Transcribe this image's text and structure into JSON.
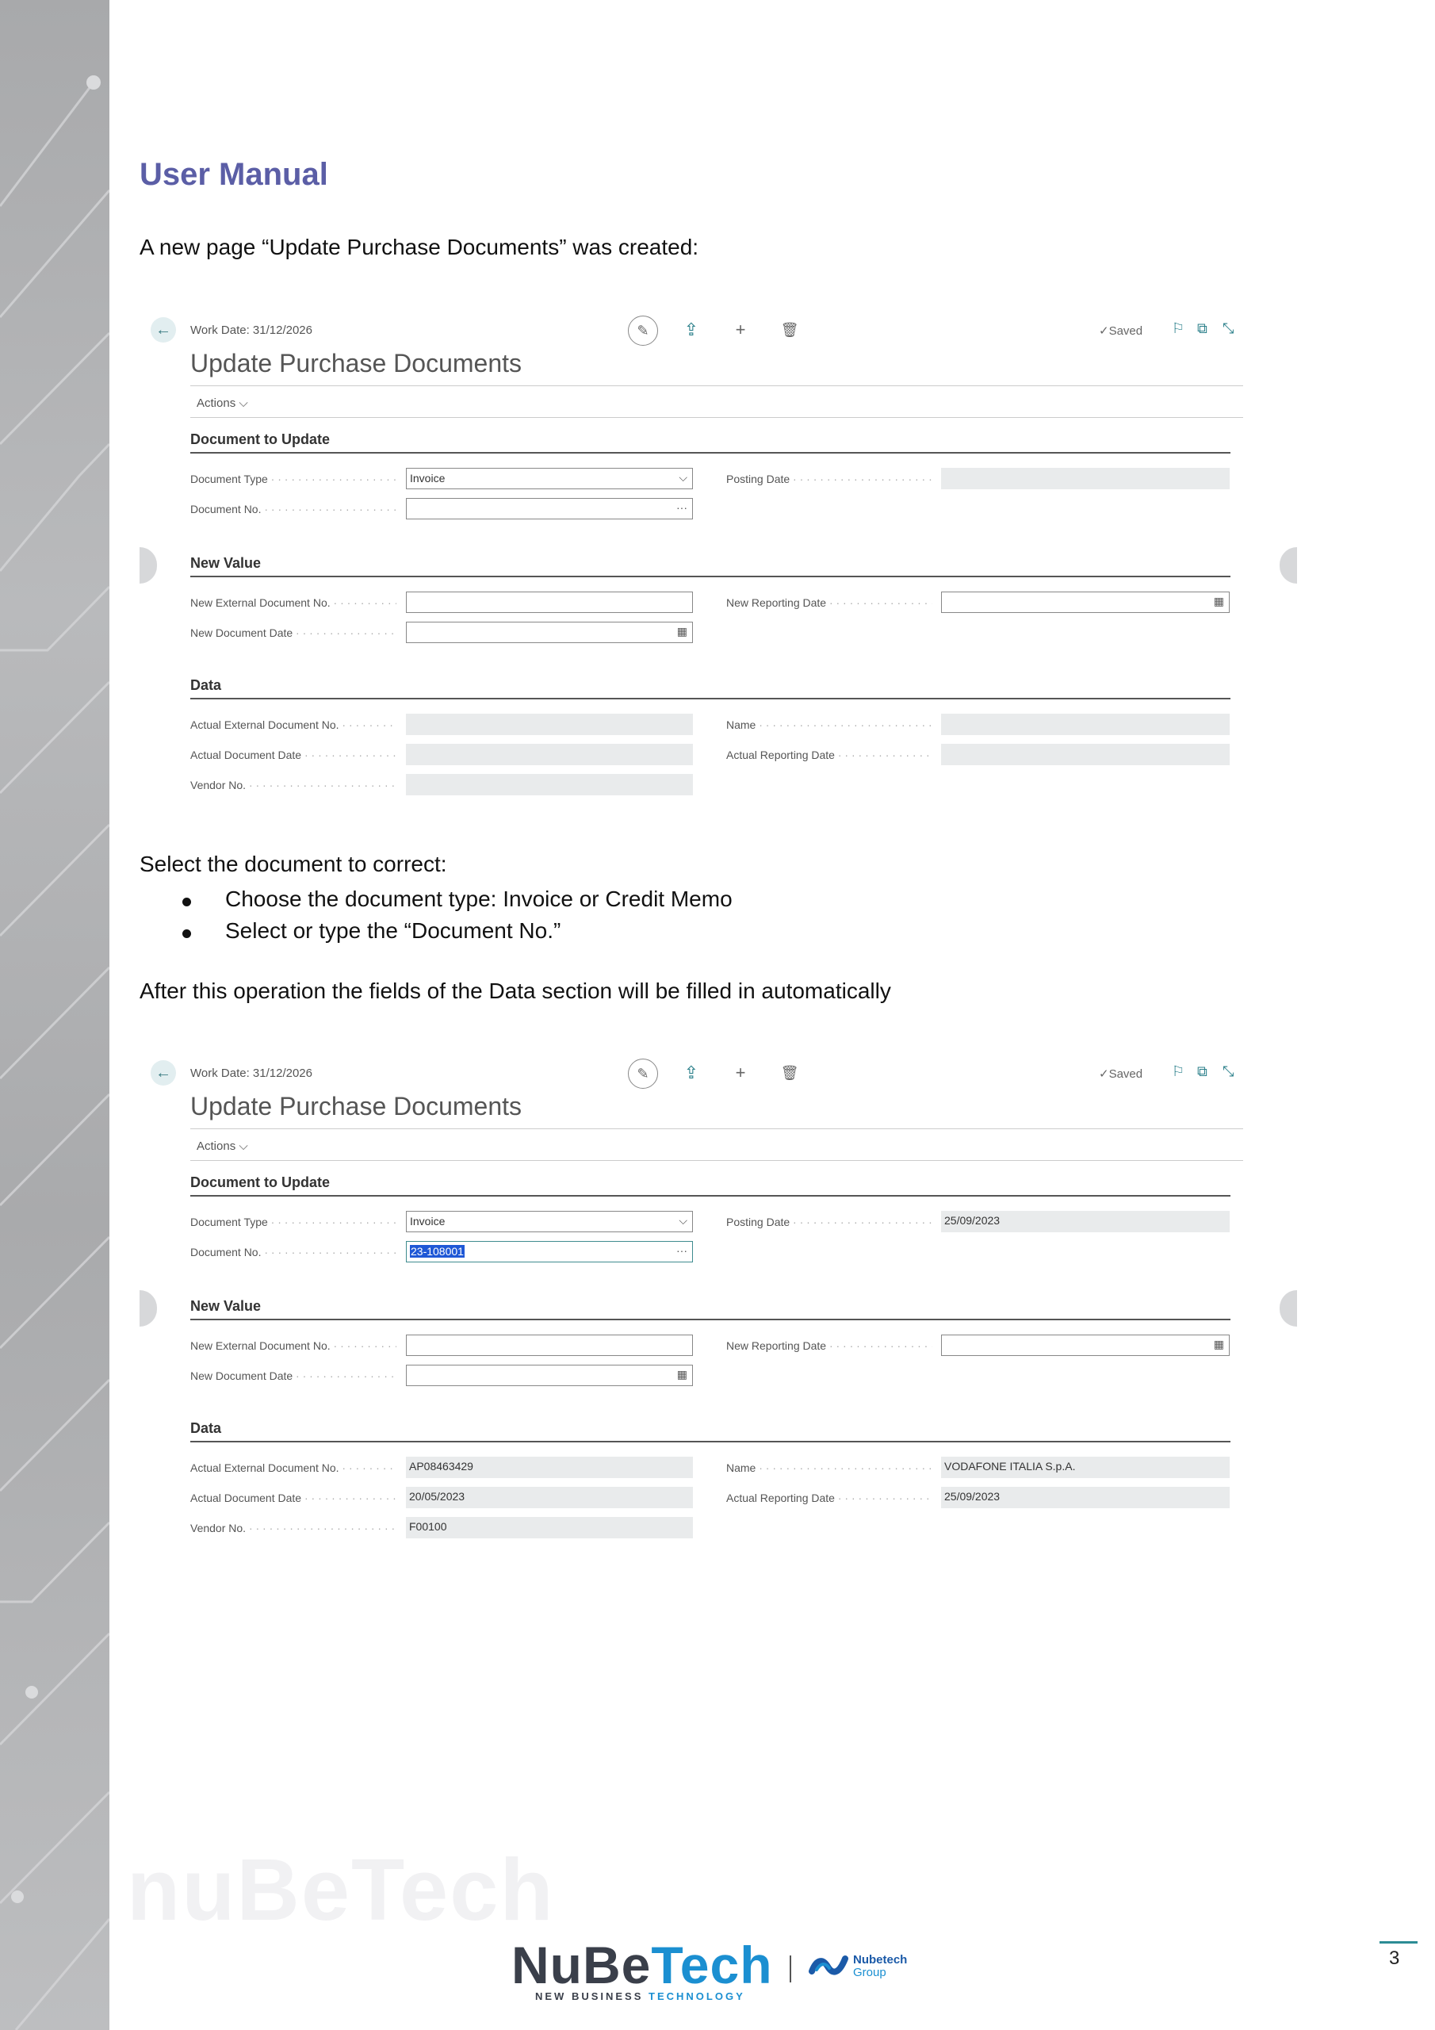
{
  "heading": "User Manual",
  "intro": "A new page “Update Purchase Documents” was created:",
  "select_text": "Select the document to correct:",
  "bullets": [
    "Choose the document type: Invoice or Credit Memo",
    "Select or type the “Document No.”"
  ],
  "after_text": "After this operation the fields of the Data section will be filled in automatically",
  "screens": [
    {
      "work_date": "Work Date: 31/12/2026",
      "saved": "✓Saved",
      "title": "Update Purchase Documents",
      "actions": "Actions ⌵",
      "sections": {
        "doc_to_update": "Document to Update",
        "new_value": "New Value",
        "data": "Data"
      },
      "labels": {
        "document_type": "Document Type",
        "document_no": "Document No.",
        "posting_date": "Posting Date",
        "new_external_doc_no": "New External Document No.",
        "new_document_date": "New Document Date",
        "new_reporting_date": "New Reporting Date",
        "actual_external_doc_no": "Actual External Document No.",
        "actual_document_date": "Actual Document Date",
        "vendor_no": "Vendor No.",
        "name": "Name",
        "actual_reporting_date": "Actual Reporting Date"
      },
      "values": {
        "document_type": "Invoice",
        "document_no": "",
        "posting_date": "",
        "new_external_doc_no": "",
        "new_document_date": "",
        "new_reporting_date": "",
        "actual_external_doc_no": "",
        "actual_document_date": "",
        "vendor_no": "",
        "name": "",
        "actual_reporting_date": ""
      }
    },
    {
      "work_date": "Work Date: 31/12/2026",
      "saved": "✓Saved",
      "title": "Update Purchase Documents",
      "actions": "Actions ⌵",
      "sections": {
        "doc_to_update": "Document to Update",
        "new_value": "New Value",
        "data": "Data"
      },
      "labels": {
        "document_type": "Document Type",
        "document_no": "Document No.",
        "posting_date": "Posting Date",
        "new_external_doc_no": "New External Document No.",
        "new_document_date": "New Document Date",
        "new_reporting_date": "New Reporting Date",
        "actual_external_doc_no": "Actual External Document No.",
        "actual_document_date": "Actual Document Date",
        "vendor_no": "Vendor No.",
        "name": "Name",
        "actual_reporting_date": "Actual Reporting Date"
      },
      "values": {
        "document_type": "Invoice",
        "document_no": "23-108001",
        "posting_date": "25/09/2023",
        "new_external_doc_no": "",
        "new_document_date": "",
        "new_reporting_date": "",
        "actual_external_doc_no": "AP08463429",
        "actual_document_date": "20/05/2023",
        "vendor_no": "F00100",
        "name": "VODAFONE ITALIA S.p.A.",
        "actual_reporting_date": "25/09/2023"
      }
    }
  ],
  "footer": {
    "watermark": "nuBeTech",
    "logo_part1": "NuBe",
    "logo_part2": "Tech",
    "tagline_part1": "NEW BUSINESS ",
    "tagline_part2": "TECHNOLOGY",
    "group_name": "Nubetech",
    "group_sub": "Group",
    "page_number": "3"
  },
  "colors": {
    "heading": "#5b5ea6",
    "accent_teal": "#2a7f8a",
    "logo_blue": "#1b8fd1",
    "logo_dark": "#3a3f4a"
  }
}
